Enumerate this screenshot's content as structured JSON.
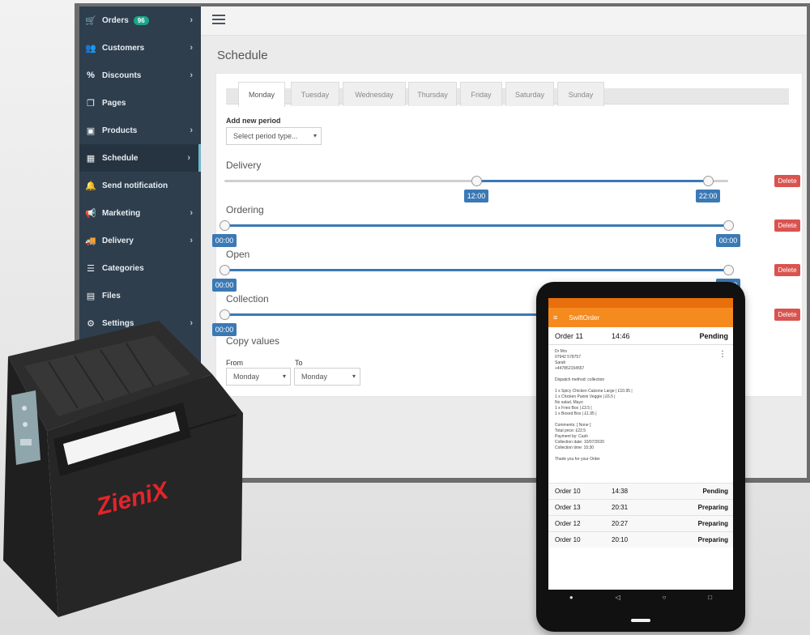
{
  "sidebar": {
    "items": [
      {
        "label": "Orders",
        "icon": "cart-icon",
        "badge": "96",
        "chevron": true
      },
      {
        "label": "Customers",
        "icon": "users-icon",
        "chevron": true
      },
      {
        "label": "Discounts",
        "icon": "percent-icon",
        "chevron": true
      },
      {
        "label": "Pages",
        "icon": "pages-icon",
        "chevron": false
      },
      {
        "label": "Products",
        "icon": "box-icon",
        "chevron": true
      },
      {
        "label": "Schedule",
        "icon": "calendar-icon",
        "chevron": true,
        "active": true
      },
      {
        "label": "Send notification",
        "icon": "bell-icon",
        "chevron": false
      },
      {
        "label": "Marketing",
        "icon": "megaphone-icon",
        "chevron": true
      },
      {
        "label": "Delivery",
        "icon": "truck-icon",
        "chevron": true
      },
      {
        "label": "Categories",
        "icon": "list-icon",
        "chevron": false
      },
      {
        "label": "Files",
        "icon": "file-icon",
        "chevron": false
      },
      {
        "label": "Settings",
        "icon": "gear-icon",
        "chevron": true
      }
    ]
  },
  "page": {
    "title": "Schedule"
  },
  "tabs": [
    "Monday",
    "Tuesday",
    "Wednesday",
    "Thursday",
    "Friday",
    "Saturday",
    "Sunday"
  ],
  "active_tab": "Monday",
  "add_period": {
    "label": "Add new period",
    "placeholder": "Select period type..."
  },
  "periods": [
    {
      "title": "Delivery",
      "from": "12:00",
      "to": "22:00",
      "start_fraction": 0.5,
      "end_fraction": 0.96,
      "delete_label": "Delete"
    },
    {
      "title": "Ordering",
      "from": "00:00",
      "to": "00:00",
      "start_fraction": 0.0,
      "end_fraction": 1.0,
      "delete_label": "Delete"
    },
    {
      "title": "Open",
      "from": "00:00",
      "to": "00:00",
      "start_fraction": 0.0,
      "end_fraction": 1.0,
      "delete_label": "Delete"
    },
    {
      "title": "Collection",
      "from": "00:00",
      "to": "00:00",
      "start_fraction": 0.0,
      "end_fraction": 1.0,
      "delete_label": "Delete"
    }
  ],
  "copy": {
    "title": "Copy values",
    "from_label": "From",
    "to_label": "To",
    "from_value": "Monday",
    "to_value": "Monday"
  },
  "tablet": {
    "app_title": "SwiftOrder",
    "current_order": {
      "label": "Order 11",
      "time": "14:46",
      "status": "Pending"
    },
    "detail_lines": [
      "Dr Mrs",
      "07942 578757",
      "Sarah",
      "+447852154557",
      "",
      "Dispatch method: collection",
      "",
      "1 x Spicy Chicken Calzone Large | £10.95 |",
      "1 x Chicken Panini Veggie | £6.5 |",
      "   No salad, Mayo",
      "1 x Fries Box | £3.5 |",
      "1 x Boxed Box | £1.95 |",
      "",
      "Comments: [ None ]",
      "Total price: £22.5",
      "Payment by: Cash",
      "Collection date: 10/07/2020",
      "Collection time: 15:30",
      "",
      "Thank you for your Order"
    ],
    "orders": [
      {
        "label": "Order 10",
        "time": "14:38",
        "status": "Pending"
      },
      {
        "label": "Order 13",
        "time": "20:31",
        "status": "Preparing"
      },
      {
        "label": "Order 12",
        "time": "20:27",
        "status": "Preparing"
      },
      {
        "label": "Order 10",
        "time": "20:10",
        "status": "Preparing"
      }
    ]
  },
  "printer": {
    "brand": "ZieniX"
  },
  "colors": {
    "sidebar": "#2e3e4d",
    "accent": "#3b79b5",
    "delete": "#d9534f",
    "app_orange": "#f58a1f",
    "brand_red": "#e3242b"
  }
}
